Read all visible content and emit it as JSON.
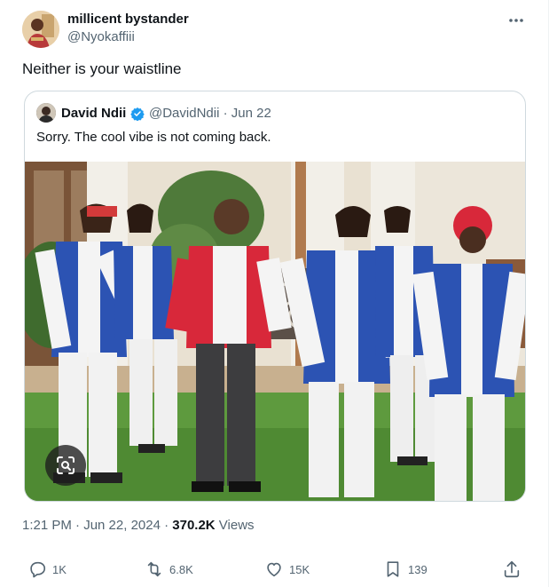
{
  "author": {
    "display_name": "millicent bystander",
    "handle": "@Nyokaffiii"
  },
  "tweet": {
    "text": "Neither is your waistline"
  },
  "quoted_tweet": {
    "display_name": "David Ndii",
    "handle_date": "@DavidNdii · Jun 22",
    "text": "Sorry. The cool vibe is not coming back."
  },
  "meta": {
    "time_date": "1:21 PM · Jun 22, 2024 · ",
    "views_count": "370.2K",
    "views_label": " Views"
  },
  "actions": {
    "replies": "1K",
    "reposts": "6.8K",
    "likes": "15K",
    "bookmarks": "139"
  },
  "colors": {
    "text_primary": "#0f1419",
    "text_secondary": "#536471",
    "border": "#cfd9de",
    "verified": "#1d9bf0"
  }
}
